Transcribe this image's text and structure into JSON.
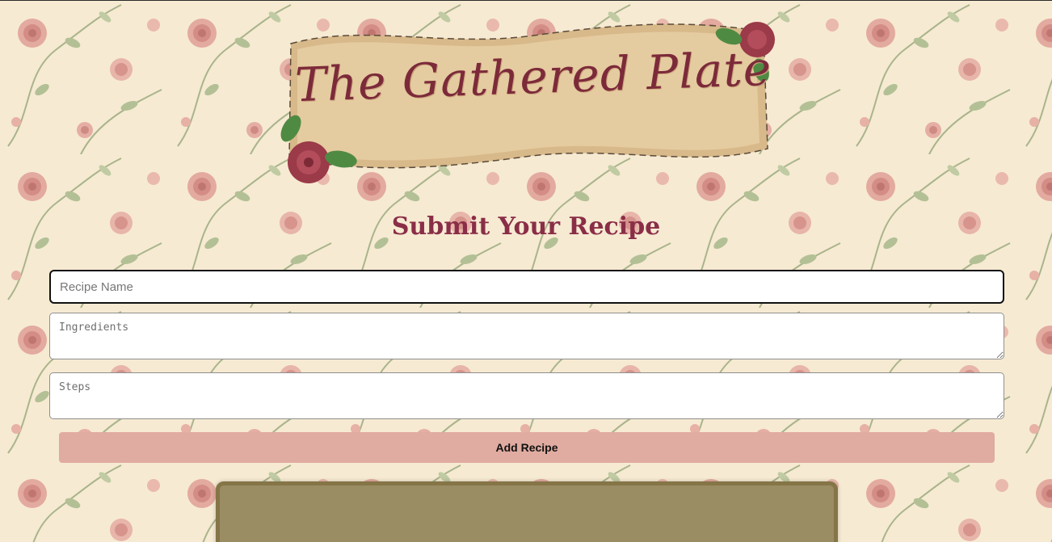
{
  "header": {
    "banner_title": "The Gathered Plate"
  },
  "form": {
    "title": "Submit Your Recipe",
    "recipe_name_placeholder": "Recipe Name",
    "ingredients_placeholder": "Ingredients",
    "steps_placeholder": "Steps",
    "submit_label": "Add Recipe"
  },
  "colors": {
    "title_color": "#8a2e47",
    "button_color": "#e0aba0",
    "panel_color": "#9a8c63",
    "background": "#f6ead2"
  },
  "icons": [
    "rose-decoration-icon",
    "leaf-icon"
  ]
}
